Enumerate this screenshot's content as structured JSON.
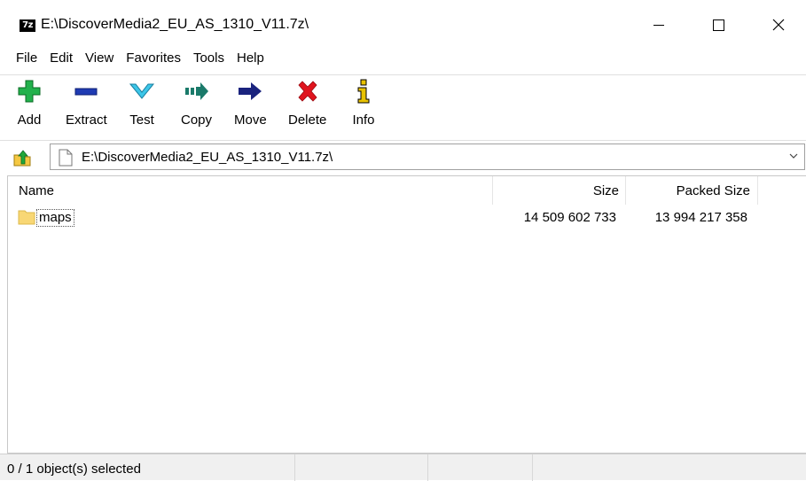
{
  "window": {
    "app_icon_text": "7z",
    "title": "E:\\DiscoverMedia2_EU_AS_1310_V11.7z\\"
  },
  "menu": [
    "File",
    "Edit",
    "View",
    "Favorites",
    "Tools",
    "Help"
  ],
  "toolbar": {
    "add": "Add",
    "extract": "Extract",
    "test": "Test",
    "copy": "Copy",
    "move": "Move",
    "delete": "Delete",
    "info": "Info"
  },
  "address": {
    "path": "E:\\DiscoverMedia2_EU_AS_1310_V11.7z\\"
  },
  "columns": {
    "name": "Name",
    "size": "Size",
    "packed_size": "Packed Size"
  },
  "rows": [
    {
      "name": "maps",
      "size": "14 509 602 733",
      "packed_size": "13 994 217 358"
    }
  ],
  "status": {
    "selection": "0 / 1 object(s) selected"
  },
  "colors": {
    "add_green": "#22b14c",
    "extract_blue": "#1f3bb3",
    "test_cyan": "#3cc6e8",
    "copy_teal": "#1a7a6a",
    "move_navy": "#1a237e",
    "delete_red": "#e0141e",
    "info_yellow": "#e8c200",
    "folder": "#f8d775"
  }
}
